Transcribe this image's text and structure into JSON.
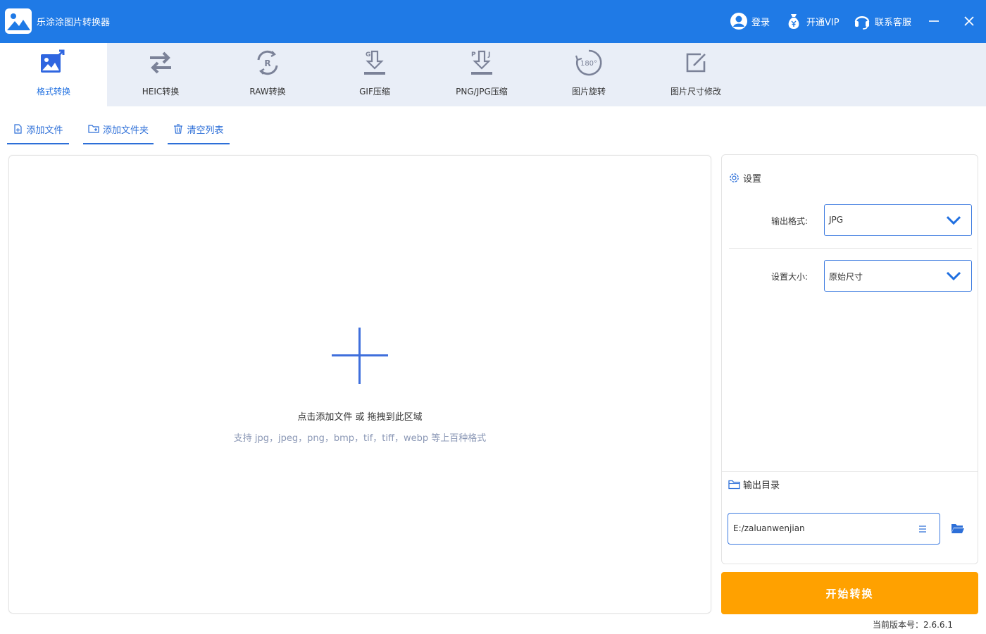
{
  "app": {
    "title": "乐涂涂图片转换器"
  },
  "header": {
    "login": "登录",
    "vip": "开通VIP",
    "support": "联系客服"
  },
  "tabs": [
    {
      "label": "格式转换",
      "icon": "image-convert-icon",
      "active": true
    },
    {
      "label": "HEIC转换",
      "icon": "swap-arrows-icon"
    },
    {
      "label": "RAW转换",
      "icon": "raw-cycle-icon"
    },
    {
      "label": "GIF压缩",
      "icon": "gif-compress-icon"
    },
    {
      "label": "PNG/JPG压缩",
      "icon": "png-jpg-compress-icon"
    },
    {
      "label": "图片旋转",
      "icon": "rotate-180-icon"
    },
    {
      "label": "图片尺寸修改",
      "icon": "resize-edit-icon"
    }
  ],
  "tab_icon_text": {
    "raw": "R",
    "gif": "G",
    "png_p": "P",
    "png_j": "J",
    "rotate": "180°"
  },
  "actions": {
    "add_file": "添加文件",
    "add_folder": "添加文件夹",
    "clear_list": "清空列表"
  },
  "dropzone": {
    "main_text": "点击添加文件 或 拖拽到此区域",
    "sub_text": "支持 jpg，jpeg，png，bmp，tif，tiff，webp 等上百种格式"
  },
  "settings": {
    "title": "设置",
    "output_format_label": "输出格式:",
    "output_format_value": "JPG",
    "size_label": "设置大小:",
    "size_value": "原始尺寸",
    "output_dir_title": "输出目录",
    "output_dir_value": "E:/zaluanwenjian"
  },
  "start_button": "开始转换",
  "version": "当前版本号：2.6.6.1",
  "colors": {
    "primary": "#1f7ae6",
    "accent": "#ffa100",
    "tab_bg": "#e9eef7"
  }
}
